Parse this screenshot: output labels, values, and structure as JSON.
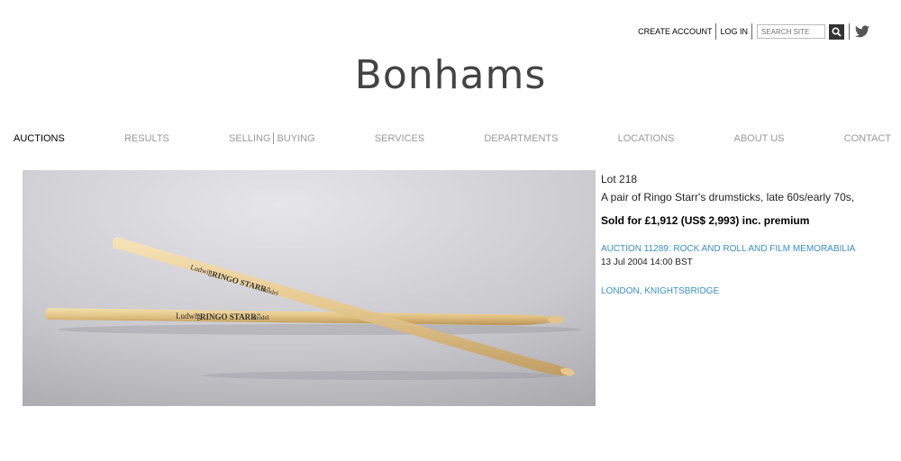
{
  "utility": {
    "create_account": "CREATE ACCOUNT",
    "log_in": "LOG IN",
    "search_placeholder": "SEARCH SITE"
  },
  "logo": "Bonhams",
  "nav": {
    "auctions": "AUCTIONS",
    "results": "RESULTS",
    "selling": "SELLING",
    "buying": "BUYING",
    "services": "SERVICES",
    "departments": "DEPARTMENTS",
    "locations": "LOCATIONS",
    "about_us": "ABOUT US",
    "contact": "CONTACT"
  },
  "lot": {
    "number": "Lot 218",
    "title": "A pair of Ringo Starr's drumsticks, late 60s/early 70s,",
    "sold": "Sold for £1,912 (US$ 2,993) inc. premium",
    "auction": "AUCTION 11289: ROCK AND ROLL AND FILM MEMORABILIA",
    "date": "13 Jul 2004 14:00 BST",
    "location": "LONDON, KNIGHTSBRIDGE"
  },
  "photo": {
    "stick_brand": "Ludwig",
    "stick_label": "\"RINGO STARR\"",
    "stick_model": "model"
  },
  "colors": {
    "link": "#3a8fc8",
    "nav_inactive": "#999999",
    "logo": "#444444"
  }
}
